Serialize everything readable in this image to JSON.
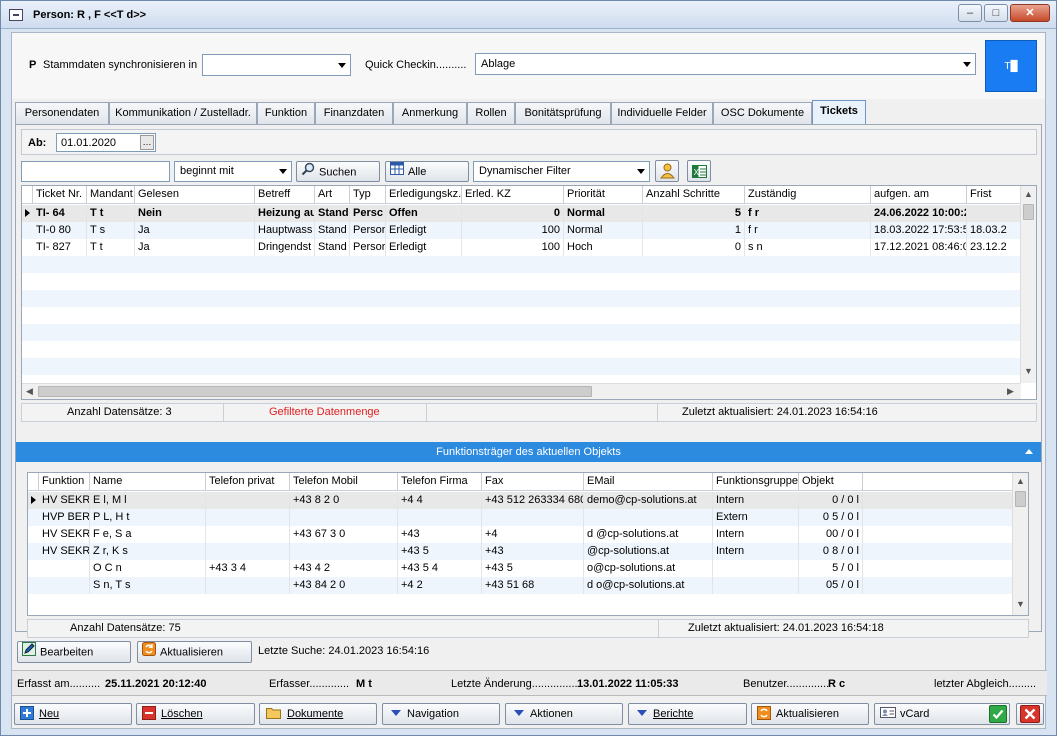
{
  "window": {
    "title": "Person: R          , F              <<T                     d>>",
    "buttons": {
      "minimize": "–",
      "maximize": "□",
      "close": "✕"
    }
  },
  "topform": {
    "p_label": "P",
    "sync_label": "Stammdaten synchronisieren in",
    "sync_value": "",
    "checkin_label": "Quick Checkin..........",
    "checkin_value": "Ablage",
    "avatar_text": "T█"
  },
  "tabs": [
    "Personendaten",
    "Kommunikation / Zustelladr.",
    "Funktion",
    "Finanzdaten",
    "Anmerkung",
    "Rollen",
    "Bonitätsprüfung",
    "Individuelle Felder",
    "OSC Dokumente",
    "Tickets"
  ],
  "active_tab": "Tickets",
  "tickets": {
    "ab_label": "Ab:",
    "ab_value": "01.01.2020",
    "search_text": "",
    "match_mode": "beginnt mit",
    "search_button": "Suchen",
    "all_button": "Alle",
    "filter_value": "Dynamischer Filter",
    "columns": [
      "Ticket Nr.",
      "Mandant",
      "Gelesen",
      "Betreff",
      "Art",
      "Typ",
      "Erledigungskz.",
      "Erled. KZ",
      "Priorität",
      "Anzahl Schritte",
      "Zuständig",
      "aufgen. am",
      "Frist"
    ],
    "rows": [
      [
        "TI-        64",
        "T          t",
        "Nein",
        "Heizung au",
        "Stand",
        "Persc",
        "Offen",
        "0",
        "Normal",
        "5",
        "f          r",
        "24.06.2022 10:00:2",
        ""
      ],
      [
        "TI-0       80",
        "T          s",
        "Ja",
        "Hauptwass",
        "Stand",
        "Persor",
        "Erledigt",
        "100",
        "Normal",
        "1",
        "f          r",
        "18.03.2022 17:53:5",
        "18.03.2"
      ],
      [
        "TI-       827",
        "T          t",
        "Ja",
        "Dringendst",
        "Stand",
        "Persor",
        "Erledigt",
        "100",
        "Hoch",
        "0",
        "s          n",
        "17.12.2021 08:46:0",
        "23.12.2"
      ]
    ],
    "count_label": "Anzahl Datensätze: 3",
    "filtered_label": "Gefilterte Datenmenge",
    "updated_label": "Zuletzt aktualisiert: 24.01.2023 16:54:16"
  },
  "funktion": {
    "header": "Funktionsträger des aktuellen Objekts",
    "columns": [
      "Funktion",
      "Name",
      "Telefon privat",
      "Telefon Mobil",
      "Telefon Firma",
      "Fax",
      "EMail",
      "Funktionsgruppe",
      "Objekt"
    ],
    "rows": [
      [
        "HV SEKR",
        "E                    l, M          l",
        "",
        "+43          8       2        0",
        "+4                         4",
        "+43 512 263334 680",
        "demo@cp-solutions.at",
        "Intern",
        "0           / 0 l"
      ],
      [
        "HVP BER",
        "P        L, H        t",
        "",
        "",
        "",
        "",
        "",
        "Extern",
        "0        5 / 0 l"
      ],
      [
        "HV SEKR",
        "F             e, S        a",
        "",
        "+43 67         3        0",
        "+43",
        "+4",
        "d        @cp-solutions.at",
        "Intern",
        "00        / 0 l"
      ],
      [
        "HV SEKR",
        "Z                r, K        s",
        "",
        "",
        "+43 5",
        "+43",
        "        @cp-solutions.at",
        "Intern",
        "0   8     / 0 l"
      ],
      [
        "",
        "O      C          n",
        "+43           3     4",
        "+43          4         2",
        "+43 5           4",
        "+43 5",
        "              o@cp-solutions.at",
        "",
        "5 / 0 l"
      ],
      [
        "",
        "S        n, T          s",
        "",
        "+43       84      2       0",
        "+4          2",
        "+43 51            68",
        "d        o@cp-solutions.at",
        "",
        "05 / 0 l"
      ]
    ],
    "count_label": "Anzahl Datensätze: 75",
    "updated_label": "Zuletzt aktualisiert: 24.01.2023 16:54:18"
  },
  "panel_buttons": {
    "edit": "Bearbeiten",
    "refresh": "Aktualisieren",
    "last_search": "Letzte Suche: 24.01.2023 16:54:16"
  },
  "infobar": {
    "erfasst_label": "Erfasst am..........",
    "erfasst_value": "25.11.2021 20:12:40",
    "erfasser_label": "Erfasser.............",
    "erfasser_value": "M                   t",
    "aenderung_label": "Letzte Änderung...............",
    "aenderung_value": "13.01.2022 11:05:33",
    "benutzer_label": "Benutzer..............",
    "benutzer_value": "R              c",
    "abgleich_label": "letzter Abgleich........."
  },
  "actions": {
    "neu": "Neu",
    "loeschen": "Löschen",
    "dokumente": "Dokumente",
    "navigation": "Navigation",
    "aktionen": "Aktionen",
    "berichte": "Berichte",
    "aktualisieren": "Aktualisieren",
    "vcard": "vCard"
  },
  "colors": {
    "accent": "#2c8adf",
    "avatar": "#1a7cf2",
    "filtered": "#e02020"
  }
}
